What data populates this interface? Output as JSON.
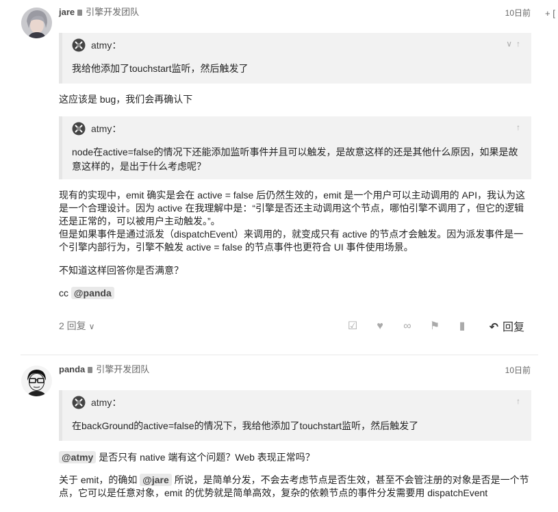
{
  "posts": [
    {
      "username": "jare",
      "group": "引擎开发团队",
      "date": "10日前",
      "quote1": {
        "author": "atmy：",
        "text": "我给他添加了touchstart监听，然后触发了"
      },
      "para1": "这应该是 bug，我们会再确认下",
      "quote2": {
        "author": "atmy：",
        "text": "node在active=false的情况下还能添加监听事件并且可以触发，是故意这样的还是其他什么原因，如果是故意这样的，是出于什么考虑呢？"
      },
      "para2_line1": "现有的实现中，emit 确实是会在 active = false 后仍然生效的，emit 是一个用户可以主动调用的 API，我认为这是一个合理设计。因为 active 在我理解中是：“引擎是否还主动调用这个节点，哪怕引擎不调用了，但它的逻辑还是正常的，可以被用户主动触发。”。",
      "para2_line2": "但是如果事件是通过派发（dispatchEvent）来调用的，就变成只有 active 的节点才会触发。因为派发事件是一个引擎内部行为，引擎不触发 active = false 的节点事件也更符合 UI 事件使用场景。",
      "para3": "不知道这样回答你是否满意？",
      "cc_prefix": "cc",
      "cc_mention": "@panda",
      "reply_count": "2 回复",
      "reply_label": "回复"
    },
    {
      "username": "panda",
      "group": "引擎开发团队",
      "date": "10日前",
      "quote1": {
        "author": "atmy：",
        "text": "在backGround的active=false的情况下，我给他添加了touchstart监听，然后触发了"
      },
      "mention1": "@atmy",
      "para1_rest": "是否只有 native 端有这个问题？Web 表现正常吗？",
      "para2_prefix": "关于 emit，的确如",
      "mention2": "@jare",
      "para2_rest": "所说，是简单分发，不会去考虑节点是否生效，甚至不会管注册的对象是否是一个节点，它可以是任意对象，emit 的优势就是简单高效，复杂的依赖节点的事件分发需要用 dispatchEvent"
    }
  ],
  "side_control": "+ [",
  "icons": [
    "lock-icon",
    "chevron-down-icon",
    "arrow-up-icon",
    "checkbox-icon",
    "heart-icon",
    "link-icon",
    "flag-icon",
    "bookmark-icon",
    "reply-icon"
  ]
}
